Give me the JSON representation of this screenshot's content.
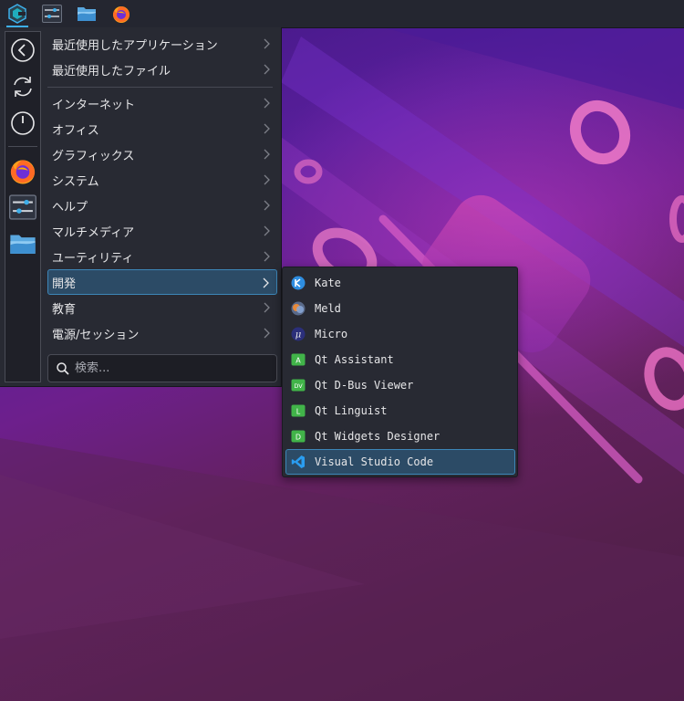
{
  "colors": {
    "accent": "#3daee9",
    "selection_bg": "#2c4b66",
    "menu_bg": "#282a33",
    "taskbar_bg": "#242630"
  },
  "taskbar": {
    "items": [
      {
        "icon": "application-launcher-icon",
        "active": true
      },
      {
        "icon": "system-settings-icon"
      },
      {
        "icon": "file-manager-icon"
      },
      {
        "icon": "firefox-icon"
      }
    ]
  },
  "menu": {
    "sidebar": [
      {
        "icon": "back-icon"
      },
      {
        "icon": "refresh-icon"
      },
      {
        "icon": "power-icon"
      },
      {
        "icon": "firefox-icon"
      },
      {
        "icon": "system-settings-icon"
      },
      {
        "icon": "file-manager-icon"
      }
    ],
    "categories": [
      {
        "label": "最近使用したアプリケーション"
      },
      {
        "label": "最近使用したファイル"
      },
      {
        "label": "インターネット"
      },
      {
        "label": "オフィス"
      },
      {
        "label": "グラフィックス"
      },
      {
        "label": "システム"
      },
      {
        "label": "ヘルプ"
      },
      {
        "label": "マルチメディア"
      },
      {
        "label": "ユーティリティ"
      },
      {
        "label": "開発",
        "selected": true
      },
      {
        "label": "教育"
      },
      {
        "label": "電源/セッション"
      }
    ],
    "search": {
      "placeholder": "検索..."
    }
  },
  "submenu": {
    "items": [
      {
        "label": "Kate",
        "icon": "kate-icon"
      },
      {
        "label": "Meld",
        "icon": "meld-icon"
      },
      {
        "label": "Micro",
        "icon": "micro-icon"
      },
      {
        "label": "Qt Assistant",
        "icon": "qt-assistant-icon",
        "badge": "A"
      },
      {
        "label": "Qt D-Bus Viewer",
        "icon": "qt-dbus-viewer-icon",
        "badge": "DV"
      },
      {
        "label": "Qt Linguist",
        "icon": "qt-linguist-icon",
        "badge": "L"
      },
      {
        "label": "Qt Widgets Designer",
        "icon": "qt-designer-icon",
        "badge": "D"
      },
      {
        "label": "Visual Studio Code",
        "icon": "vscode-icon",
        "selected": true
      }
    ]
  }
}
